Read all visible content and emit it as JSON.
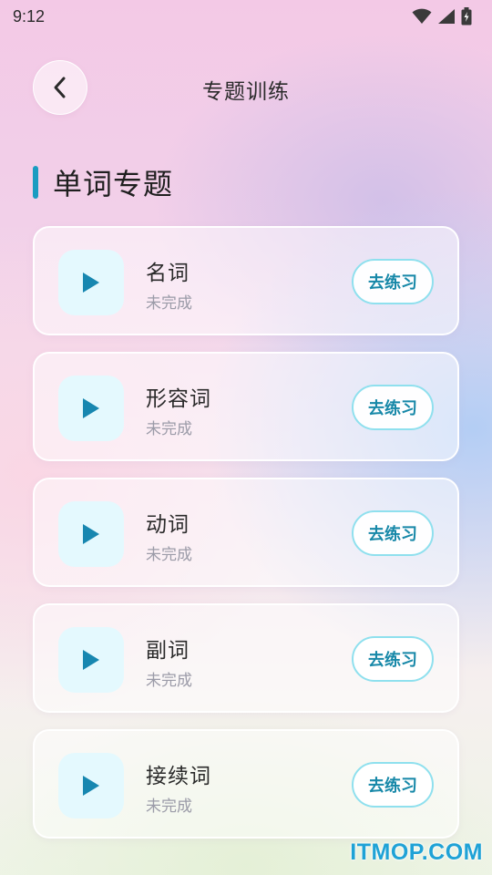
{
  "status_bar": {
    "time": "9:12",
    "icons": [
      "wifi-icon",
      "signal-icon",
      "battery-charging-icon"
    ]
  },
  "header": {
    "back_icon": "chevron-left-icon",
    "title": "专题训练"
  },
  "section": {
    "title": "单词专题",
    "accent_color": "#1a9cc1"
  },
  "topics": [
    {
      "name": "名词",
      "status": "未完成",
      "button": "去练习",
      "icon": "play-icon"
    },
    {
      "name": "形容词",
      "status": "未完成",
      "button": "去练习",
      "icon": "play-icon"
    },
    {
      "name": "动词",
      "status": "未完成",
      "button": "去练习",
      "icon": "play-icon"
    },
    {
      "name": "副词",
      "status": "未完成",
      "button": "去练习",
      "icon": "play-icon"
    },
    {
      "name": "接续词",
      "status": "未完成",
      "button": "去练习",
      "icon": "play-icon"
    }
  ],
  "colors": {
    "play_icon": "#1787b0",
    "button_text": "#1788a8",
    "button_border": "#8fe0ee",
    "icon_bg": "#e4f9fe"
  },
  "watermark": "ITMOP.COM"
}
